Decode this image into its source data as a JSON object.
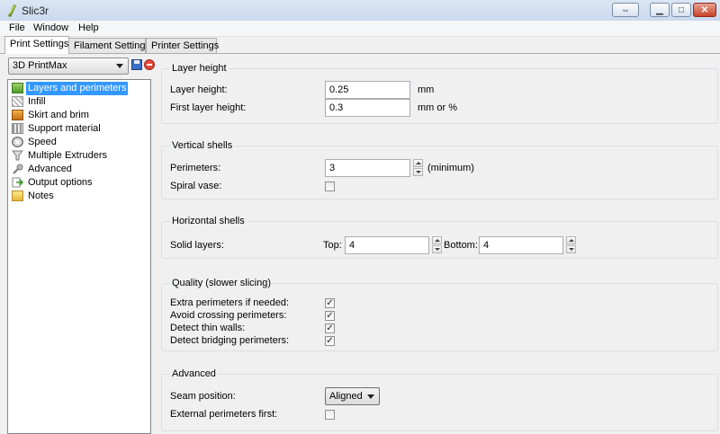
{
  "window": {
    "title": "Slic3r"
  },
  "menu": [
    "File",
    "Window",
    "Help"
  ],
  "tabs": [
    "Print Settings",
    "Filament Settings",
    "Printer Settings"
  ],
  "preset": {
    "selected": "3D PrintMax"
  },
  "tree": [
    {
      "label": "Layers and perimeters",
      "icon": "layers-icon",
      "selected": true
    },
    {
      "label": "Infill",
      "icon": "infill-icon"
    },
    {
      "label": "Skirt and brim",
      "icon": "skirt-icon"
    },
    {
      "label": "Support material",
      "icon": "support-icon"
    },
    {
      "label": "Speed",
      "icon": "speed-icon"
    },
    {
      "label": "Multiple Extruders",
      "icon": "funnel-icon"
    },
    {
      "label": "Advanced",
      "icon": "wrench-icon"
    },
    {
      "label": "Output options",
      "icon": "output-icon"
    },
    {
      "label": "Notes",
      "icon": "notes-icon"
    }
  ],
  "layer_height": {
    "title": "Layer height",
    "layer_height_label": "Layer height:",
    "layer_height_value": "0.25",
    "layer_height_unit": "mm",
    "first_layer_label": "First layer height:",
    "first_layer_value": "0.3",
    "first_layer_unit": "mm or %"
  },
  "vertical_shells": {
    "title": "Vertical shells",
    "perimeters_label": "Perimeters:",
    "perimeters_value": "3",
    "perimeters_unit": "(minimum)",
    "spiral_label": "Spiral vase:",
    "spiral_checked": false
  },
  "horizontal_shells": {
    "title": "Horizontal shells",
    "solid_label": "Solid layers:",
    "top_label": "Top:",
    "top_value": "4",
    "bottom_label": "Bottom:",
    "bottom_value": "4"
  },
  "quality": {
    "title": "Quality (slower slicing)",
    "items": [
      {
        "label": "Extra perimeters if needed:",
        "checked": true
      },
      {
        "label": "Avoid crossing perimeters:",
        "checked": true
      },
      {
        "label": "Detect thin walls:",
        "checked": true
      },
      {
        "label": "Detect bridging perimeters:",
        "checked": true
      }
    ]
  },
  "advanced": {
    "title": "Advanced",
    "seam_label": "Seam position:",
    "seam_value": "Aligned",
    "external_label": "External perimeters first:",
    "external_checked": false
  }
}
